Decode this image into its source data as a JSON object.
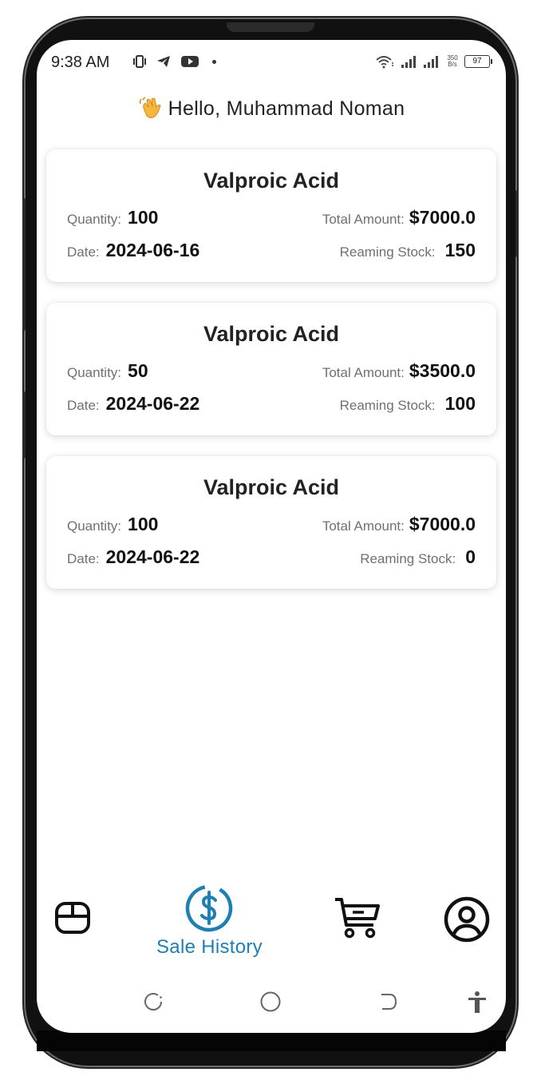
{
  "status_bar": {
    "time": "9:38 AM",
    "net_speed_value": "350",
    "net_speed_unit": "B/s",
    "battery": "97"
  },
  "greeting": "Hello, Muhammad Noman",
  "labels": {
    "quantity": "Quantity:",
    "total_amount": "Total Amount:",
    "date": "Date:",
    "remaining_stock": "Reaming Stock:"
  },
  "sales": [
    {
      "name": "Valproic Acid",
      "quantity": "100",
      "total_amount": "$7000.0",
      "date": "2024-06-16",
      "remaining_stock": "150"
    },
    {
      "name": "Valproic Acid",
      "quantity": "50",
      "total_amount": "$3500.0",
      "date": "2024-06-22",
      "remaining_stock": "100"
    },
    {
      "name": "Valproic Acid",
      "quantity": "100",
      "total_amount": "$7000.0",
      "date": "2024-06-22",
      "remaining_stock": "0"
    }
  ],
  "bottom_nav": {
    "active_label": "Sale History",
    "items": [
      "dashboard-icon",
      "dollar-circle-icon",
      "cart-icon",
      "account-icon"
    ]
  },
  "colors": {
    "accent": "#1e7fb4",
    "text": "#222222",
    "label": "#707070"
  }
}
